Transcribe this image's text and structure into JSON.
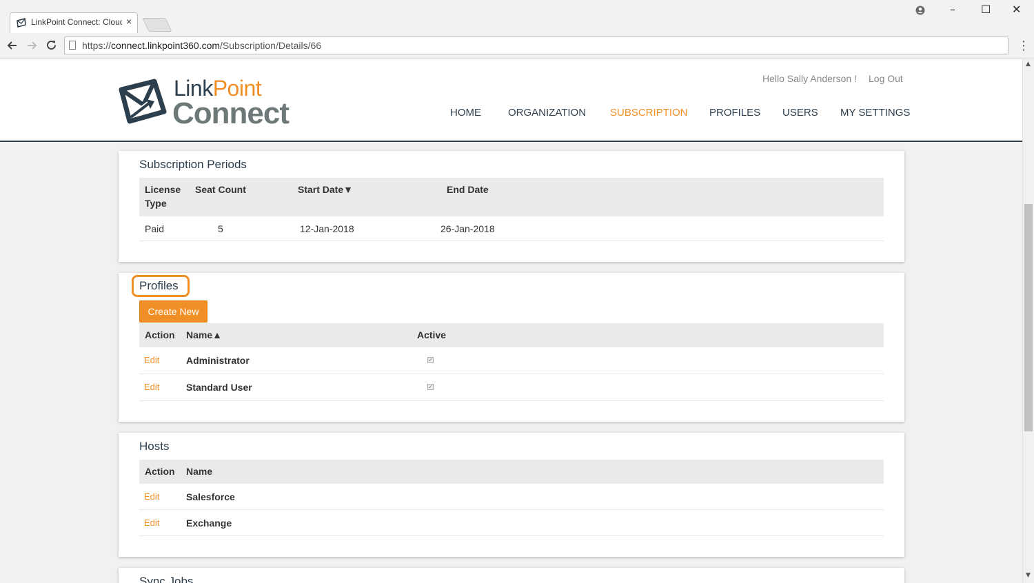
{
  "browser": {
    "tab_title": "LinkPoint Connect: Cloud",
    "tab_close": "×",
    "url_scheme": "https://",
    "url_host": "connect.linkpoint360.com",
    "url_path": "/Subscription/Details/66",
    "back_icon": "arrow-left-icon",
    "forward_icon": "arrow-right-icon",
    "reload_icon": "reload-icon",
    "menu_icon": "kebab-menu-icon",
    "window_controls": [
      "–",
      "☐",
      "✕"
    ],
    "profile_icon": "user-circle-icon"
  },
  "header": {
    "logo_link": "Link",
    "logo_point": "Point",
    "logo_connect": "Connect",
    "greeting": "Hello Sally Anderson !",
    "logout": "Log Out",
    "nav": [
      "HOME",
      "ORGANIZATION",
      "SUBSCRIPTION",
      "PROFILES",
      "USERS",
      "MY SETTINGS"
    ],
    "active_nav": "SUBSCRIPTION"
  },
  "subscription_periods": {
    "title": "Subscription Periods",
    "columns": [
      "License",
      "Type",
      "Seat Count",
      "Start Date▼",
      "End Date"
    ],
    "rows": [
      {
        "license_type": "Paid",
        "seat_count": "5",
        "start_date": "12-Jan-2018",
        "end_date": "26-Jan-2018"
      }
    ]
  },
  "profiles": {
    "title": "Profiles",
    "create_label": "Create New",
    "columns": [
      "Action",
      "Name▲",
      "Active"
    ],
    "rows": [
      {
        "action": "Edit",
        "name": "Administrator",
        "active": true
      },
      {
        "action": "Edit",
        "name": "Standard User",
        "active": true
      }
    ]
  },
  "hosts": {
    "title": "Hosts",
    "columns": [
      "Action",
      "Name"
    ],
    "rows": [
      {
        "action": "Edit",
        "name": "Salesforce"
      },
      {
        "action": "Edit",
        "name": "Exchange"
      }
    ]
  },
  "sync_jobs": {
    "title": "Sync Jobs"
  },
  "colors": {
    "accent": "#f18f27",
    "navy": "#2d3e4c",
    "gray_logo": "#6d7879"
  }
}
